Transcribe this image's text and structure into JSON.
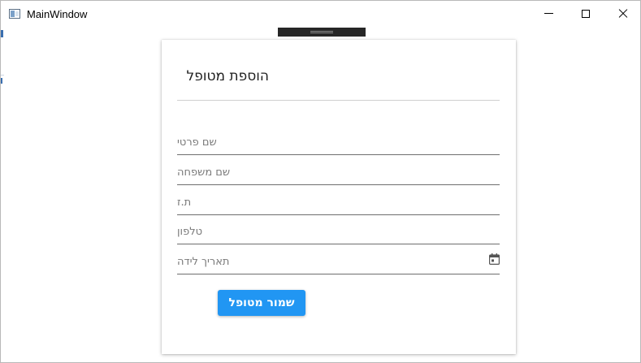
{
  "window": {
    "title": "MainWindow",
    "controls": {
      "minimize": "minimize-icon",
      "maximize": "maximize-icon",
      "close": "close-icon"
    }
  },
  "dialog": {
    "title": "הוספת מטופל",
    "fields": [
      {
        "placeholder": "שם פרטי",
        "value": ""
      },
      {
        "placeholder": "שם משפחה",
        "value": ""
      },
      {
        "placeholder": "ת.ז",
        "value": ""
      },
      {
        "placeholder": "טלפון",
        "value": ""
      },
      {
        "placeholder": "תאריך לידה",
        "value": "",
        "icon": "calendar-icon"
      }
    ],
    "save_label": "שמור מטופל"
  },
  "colors": {
    "accent": "#2196f3",
    "drag_bar": "#262626",
    "underline": "#6e6e6e"
  }
}
